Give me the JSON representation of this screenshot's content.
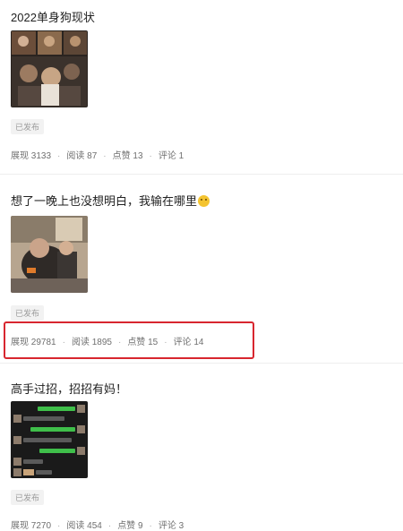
{
  "posts": [
    {
      "title": "2022单身狗现状",
      "badge": "已发布",
      "stats": {
        "views_label": "展现",
        "views": "3133",
        "reads_label": "阅读",
        "reads": "87",
        "likes_label": "点赞",
        "likes": "13",
        "comments_label": "评论",
        "comments": "1"
      }
    },
    {
      "title": "想了一晚上也没想明白，我输在哪里",
      "badge": "已发布",
      "stats": {
        "views_label": "展现",
        "views": "29781",
        "reads_label": "阅读",
        "reads": "1895",
        "likes_label": "点赞",
        "likes": "15",
        "comments_label": "评论",
        "comments": "14"
      }
    },
    {
      "title": "高手过招，招招有妈！",
      "badge": "已发布",
      "stats": {
        "views_label": "展现",
        "views": "7270",
        "reads_label": "阅读",
        "reads": "454",
        "likes_label": "点赞",
        "likes": "9",
        "comments_label": "评论",
        "comments": "3"
      }
    }
  ],
  "separator": "·",
  "colors": {
    "highlight": "#d8262f",
    "chat_bg": "#1a1a1a",
    "chat_bubble": "#3fbf4a"
  }
}
